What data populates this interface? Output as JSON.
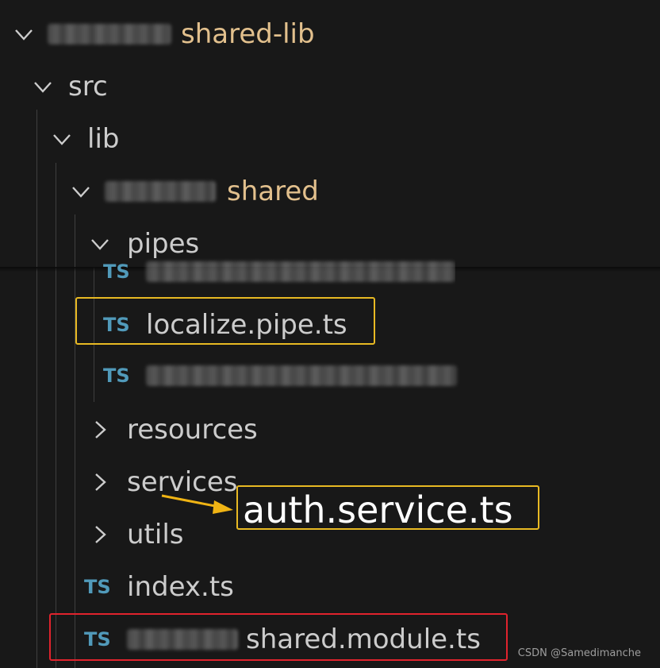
{
  "explorer": {
    "root": {
      "label": "shared-lib",
      "expanded": true
    },
    "src": {
      "label": "src",
      "expanded": true
    },
    "lib": {
      "label": "lib",
      "expanded": true
    },
    "shared": {
      "label": "shared",
      "expanded": true
    },
    "pipes": {
      "label": "pipes",
      "expanded": true
    },
    "pipe_files": [
      {
        "icon": "TS",
        "label": "",
        "redacted": true
      },
      {
        "icon": "TS",
        "label": "localize.pipe.ts",
        "redacted": false
      },
      {
        "icon": "TS",
        "label": "",
        "redacted": true
      }
    ],
    "folders": [
      {
        "label": "resources",
        "expanded": false
      },
      {
        "label": "services",
        "expanded": false
      },
      {
        "label": "utils",
        "expanded": false
      }
    ],
    "index_file": {
      "icon": "TS",
      "label": "index.ts"
    },
    "module_file": {
      "icon": "TS",
      "label": "shared.module.ts"
    }
  },
  "annotation": {
    "callout_text": "auth.service.ts",
    "colors": {
      "yellow_box": "#e8b923",
      "red_box": "#e0232d",
      "arrow": "#f0b414",
      "folder_modified": "#e2c08d",
      "ts_icon": "#519aba"
    }
  },
  "watermark": "CSDN @Samedimanche"
}
